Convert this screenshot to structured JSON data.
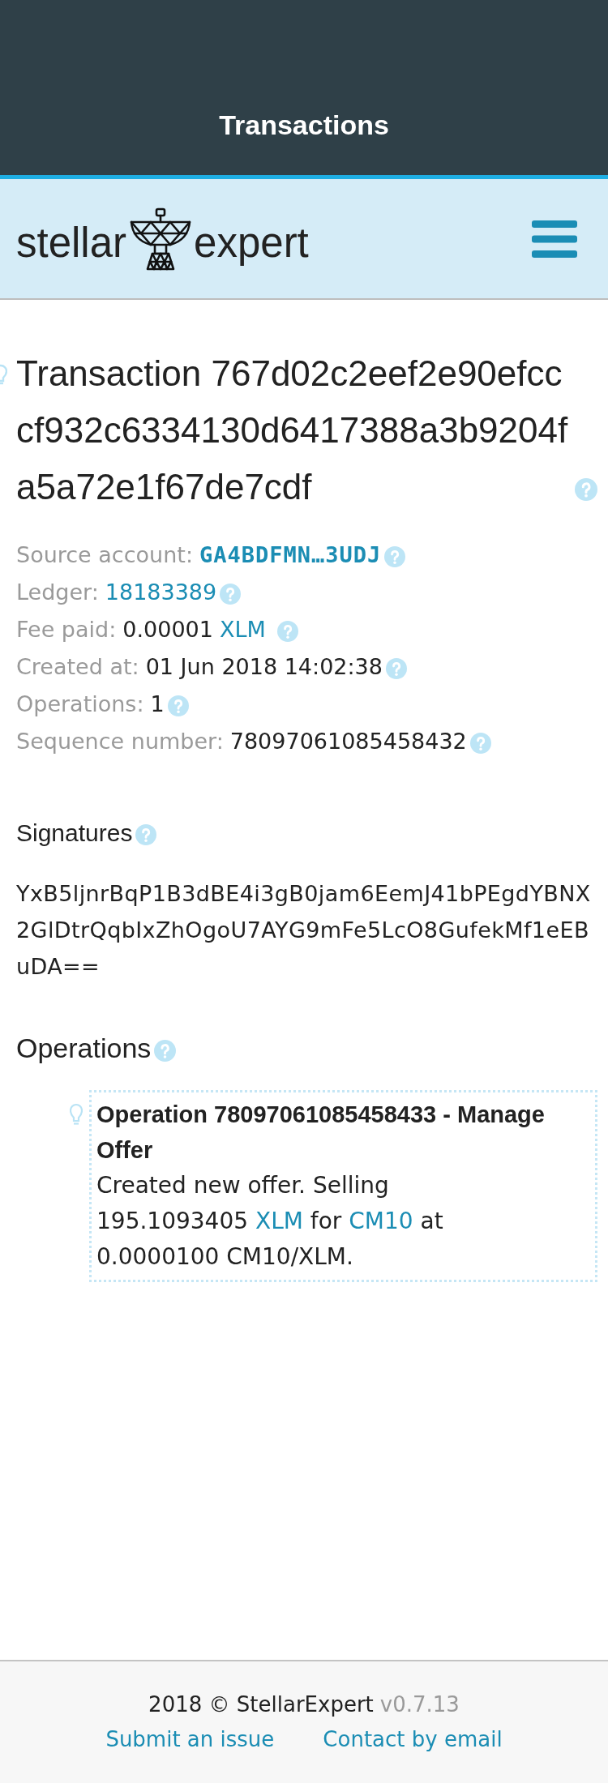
{
  "title_bar": {
    "title": "Transactions"
  },
  "header": {
    "logo_left": "stellar",
    "logo_right": "expert"
  },
  "transaction": {
    "title": "Transaction 767d02c2eef2e90efcccf932c6334130d6417388a3b9204fa5a72e1f67de7cdf",
    "details": [
      {
        "label": "Source account:",
        "kind": "account",
        "value": "GA4BDFMN…3UDJ"
      },
      {
        "label": "Ledger:",
        "kind": "link",
        "value": "18183389"
      },
      {
        "label": "Fee paid:",
        "kind": "amount",
        "value": "0.00001",
        "asset": "XLM"
      },
      {
        "label": "Created at:",
        "kind": "text",
        "value": "01 Jun 2018 14:02:38"
      },
      {
        "label": "Operations:",
        "kind": "text",
        "value": "1"
      },
      {
        "label": "Sequence number:",
        "kind": "text",
        "value": "78097061085458432"
      }
    ]
  },
  "signatures": {
    "heading": "Signatures",
    "items": [
      "YxB5ljnrBqP1B3dBE4i3gB0jam6EemJ41bPEgdYBNX2GlDtrQqbIxZhOgoU7AYG9mFe5LcO8GufekMf1eEBuDA=="
    ]
  },
  "operations": {
    "heading": "Operations",
    "items": [
      {
        "title": "Operation 78097061085458433 - Manage Offer",
        "description": [
          {
            "kind": "text",
            "text": "Created new offer. Selling"
          },
          {
            "kind": "amount",
            "text": "195.1093405",
            "asset": "XLM"
          },
          {
            "kind": "text",
            "text": "for"
          },
          {
            "kind": "link",
            "text": "CM10"
          },
          {
            "kind": "text",
            "text": "at"
          },
          {
            "kind": "text",
            "text": "0.0000100 CM10/XLM."
          }
        ]
      }
    ]
  },
  "footer": {
    "copyright": "2018 © StellarExpert",
    "version": "v0.7.13",
    "links": [
      "Submit an issue",
      "Contact by email"
    ]
  }
}
